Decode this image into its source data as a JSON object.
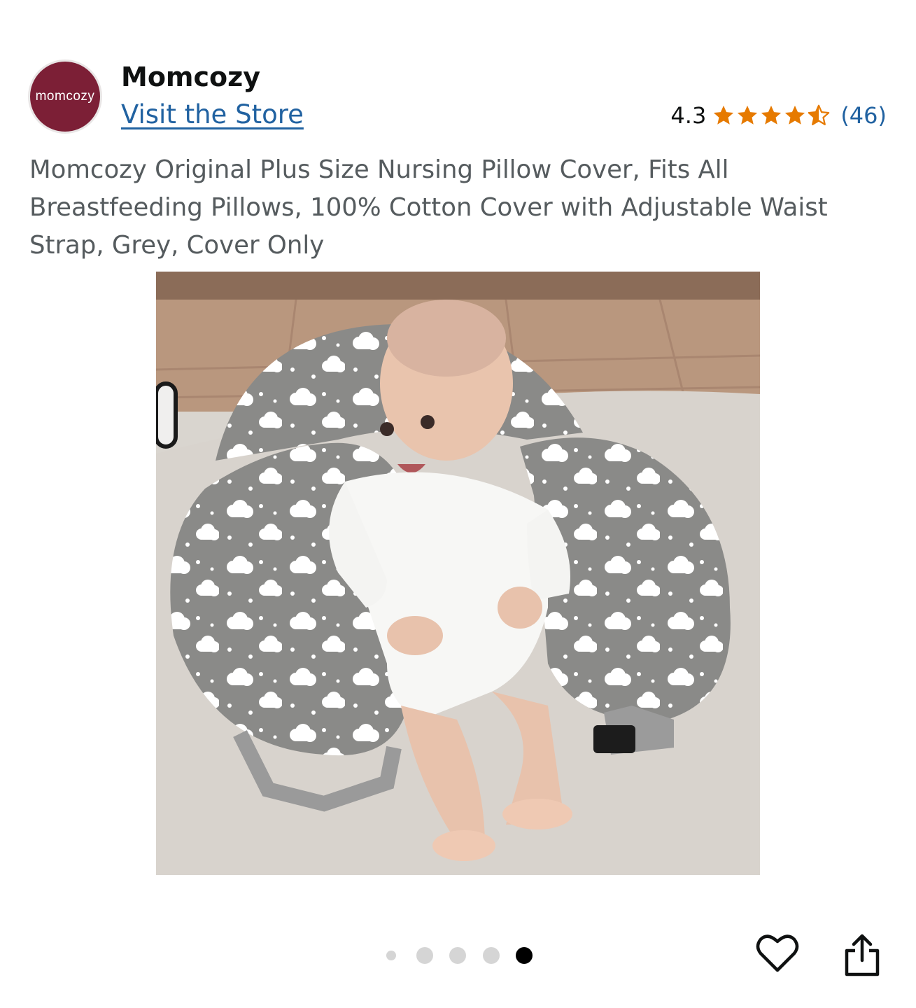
{
  "header": {
    "logo_text": "momcozy",
    "brand_name": "Momcozy",
    "visit_store": "Visit the Store"
  },
  "rating": {
    "value": "4.3",
    "stars": 4.3,
    "count": "(46)",
    "star_color": "#e67a00"
  },
  "product": {
    "title": "Momcozy Original Plus Size Nursing Pillow Cover, Fits All Breastfeeding Pillows, 100% Cotton Cover with Adjustable Waist Strap, Grey, Cover Only"
  },
  "gallery": {
    "image_count": 5,
    "active_index": 5
  },
  "icons": {
    "favorite": "heart-icon",
    "share": "share-icon"
  },
  "colors": {
    "link": "#2162a1",
    "brand": "#7c1f36"
  }
}
